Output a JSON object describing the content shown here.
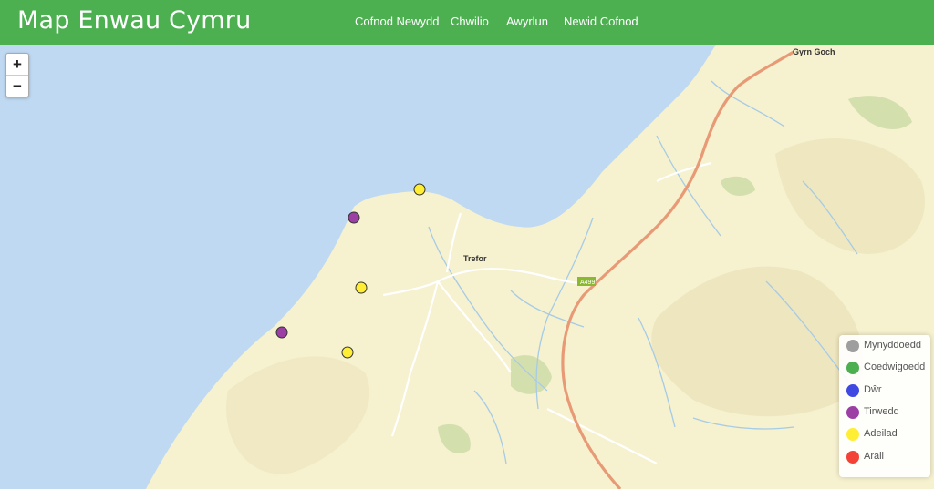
{
  "header": {
    "brand": "Map Enwau Cymru",
    "nav": [
      "Cofnod Newydd",
      "Chwilio",
      "Awyrlun",
      "Newid Cofnod"
    ]
  },
  "map": {
    "zoom_in": "+",
    "zoom_out": "−",
    "places": [
      "Trefor",
      "Gyrn Goch"
    ],
    "road_label": "A499",
    "colors": {
      "sea": "#bfd9f2",
      "land": "#f6f1cf",
      "road": "#e89a76",
      "stream": "#a6cbe6"
    }
  },
  "legend": [
    {
      "label": "Mynyddoedd",
      "color": "#9e9e9e"
    },
    {
      "label": "Coedwigoedd",
      "color": "#4caf50"
    },
    {
      "label": "Dŵr",
      "color": "#3f48e0"
    },
    {
      "label": "Tirwedd",
      "color": "#9c3fa5"
    },
    {
      "label": "Adeilad",
      "color": "#ffee33"
    },
    {
      "label": "Arall",
      "color": "#f44336"
    }
  ],
  "markers": [
    {
      "category": "Adeilad",
      "color": "#ffee33"
    },
    {
      "category": "Tirwedd",
      "color": "#9c3fa5"
    },
    {
      "category": "Adeilad",
      "color": "#ffee33"
    },
    {
      "category": "Tirwedd",
      "color": "#9c3fa5"
    },
    {
      "category": "Adeilad",
      "color": "#ffee33"
    }
  ]
}
